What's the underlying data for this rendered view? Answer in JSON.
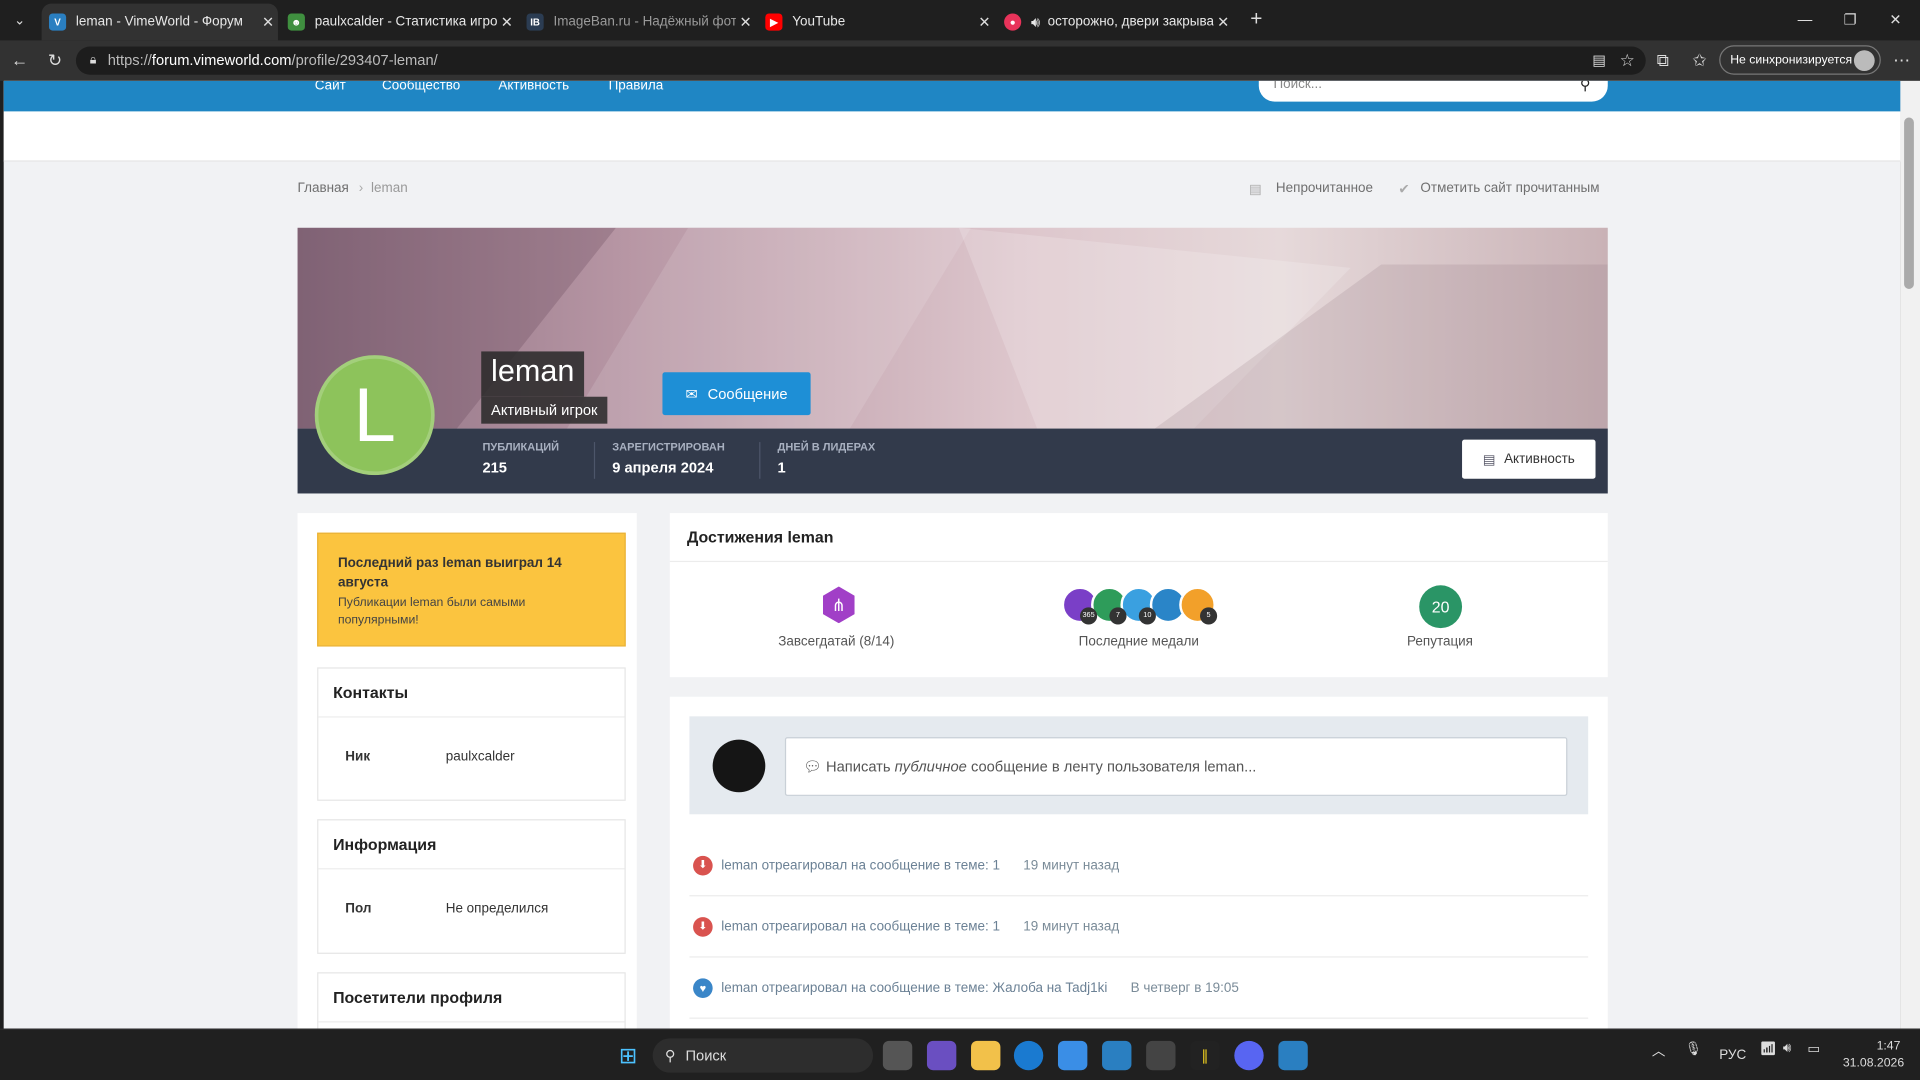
{
  "browser": {
    "tabs": [
      {
        "title": "leman - VimeWorld - Форум",
        "icon_color": "#2a7fc1",
        "icon": "V",
        "active": true
      },
      {
        "title": "paulxcalder - Статистика игрока V",
        "icon_color": "#3f8f3f",
        "icon": "☻",
        "active": false
      },
      {
        "title": "ImageBan.ru - Надёжный фотохо",
        "icon_color": "#2b3c52",
        "icon": "IB",
        "active": false
      },
      {
        "title": "YouTube",
        "icon_color": "#ff0000",
        "icon": "▶",
        "active": false
      },
      {
        "title": "осторожно, двери закрывак",
        "icon_color": "#e8335a",
        "icon": "●",
        "active": false
      }
    ],
    "url_prefix": "https://",
    "url_host": "forum.vimeworld.com",
    "url_path": "/profile/293407-leman/",
    "sync_label": "Не синхронизируется"
  },
  "site": {
    "nav": [
      "Сайт",
      "Сообщество",
      "Активность",
      "Правила"
    ],
    "search_placeholder": "Поиск...",
    "breadcrumb": {
      "home": "Главная",
      "current": "leman"
    },
    "unread": "Непрочитанное",
    "mark_read": "Отметить сайт прочитанным"
  },
  "profile": {
    "avatar_letter": "L",
    "name": "leman",
    "title": "Активный игрок",
    "message_button": "Сообщение",
    "activity_button": "Активность",
    "stats": [
      {
        "label": "ПУБЛИКАЦИЙ",
        "value": "215"
      },
      {
        "label": "ЗАРЕГИСТРИРОВАН",
        "value": "9 апреля 2024"
      },
      {
        "label": "ДНЕЙ В ЛИДЕРАХ",
        "value": "1"
      }
    ]
  },
  "sidebar": {
    "leader_title": "Последний раз leman выиграл 14 августа",
    "leader_text": "Публикации leman были самыми популярными!",
    "contacts": {
      "heading": "Контакты",
      "key": "Ник",
      "value": "paulxcalder"
    },
    "info": {
      "heading": "Информация",
      "key": "Пол",
      "value": "Не определился"
    },
    "visitors": {
      "heading": "Посетители профиля"
    }
  },
  "achievements": {
    "heading": "Достижения leman",
    "rank_label": "Завсегдатай (8/14)",
    "medals_label": "Последние медали",
    "medal_counts": [
      "365",
      "7",
      "10",
      "",
      "5"
    ],
    "reputation_value": "20",
    "reputation_label": "Репутация"
  },
  "feed": {
    "composer_prefix": "Написать ",
    "composer_em": "публичное",
    "composer_suffix": " сообщение в ленту пользователя leman...",
    "items": [
      {
        "text": "leman отреагировал на сообщение в теме: 1",
        "time": "19 минут назад",
        "reaction": "down",
        "color": "#d9534f"
      },
      {
        "text": "leman отреагировал на сообщение в теме: 1",
        "time": "19 минут назад",
        "reaction": "down",
        "color": "#d9534f"
      },
      {
        "text": "leman отреагировал на сообщение в теме: Жалоба на Tadj1ki",
        "time": "В четверг в 19:05",
        "reaction": "heart",
        "color": "#3a86c8"
      }
    ]
  },
  "taskbar": {
    "search_label": "Поиск",
    "lang": "РУС",
    "time": "1:47",
    "date": "31.08.2026"
  }
}
